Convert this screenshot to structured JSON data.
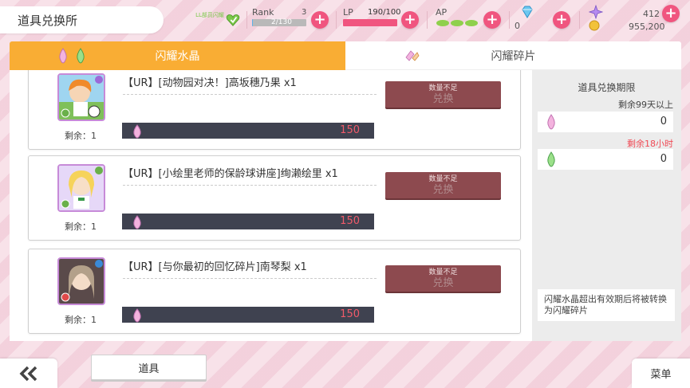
{
  "header": {
    "title": "道具兑换所",
    "badge_text": "LL部员闪耀",
    "rank": {
      "label": "Rank",
      "level": "3",
      "progress_text": "2/130",
      "fill": 0.015
    },
    "lp": {
      "label": "LP",
      "value_text": "190/100",
      "fill": 1.0
    },
    "ap": {
      "label": "AP"
    },
    "gems": {
      "value": "0"
    },
    "stars": {
      "value": "412"
    },
    "gold": {
      "value": "955,200"
    }
  },
  "tabs": [
    {
      "label": "闪耀水晶",
      "active": true,
      "icon": "crystal-icon"
    },
    {
      "label": "闪耀碎片",
      "active": false,
      "icon": "shard-icon"
    }
  ],
  "cards": [
    {
      "title": "【UR】[动物园对决！]高坂穗乃果 x1",
      "remain_label": "剩余：",
      "remain": "1",
      "cost": "150",
      "button_hint": "数量不足",
      "button_label": "兑换"
    },
    {
      "title": "【UR】[小绘里老师的保龄球讲座]绚濑绘里 x1",
      "remain_label": "剩余：",
      "remain": "1",
      "cost": "150",
      "button_hint": "数量不足",
      "button_label": "兑换"
    },
    {
      "title": "【UR】[与你最初的回忆碎片]南琴梨 x1",
      "remain_label": "剩余：",
      "remain": "1",
      "cost": "150",
      "button_hint": "数量不足",
      "button_label": "兑换"
    }
  ],
  "side": {
    "header": "道具兑换期限",
    "note_long": "剩余99天以上",
    "crystal_pink_count": "0",
    "note_short": "剩余18小时",
    "crystal_green_count": "0",
    "footer_note": "闪耀水晶超出有效期后将被转换为闪耀碎片"
  },
  "bottom": {
    "back_label": "《",
    "items_label": "道具",
    "menu_label": "菜单"
  },
  "colors": {
    "accent_orange": "#f9ad34",
    "accent_pink": "#f0557f",
    "cost_red": "#f05a6a",
    "button_disabled": "#8d4a4f"
  }
}
